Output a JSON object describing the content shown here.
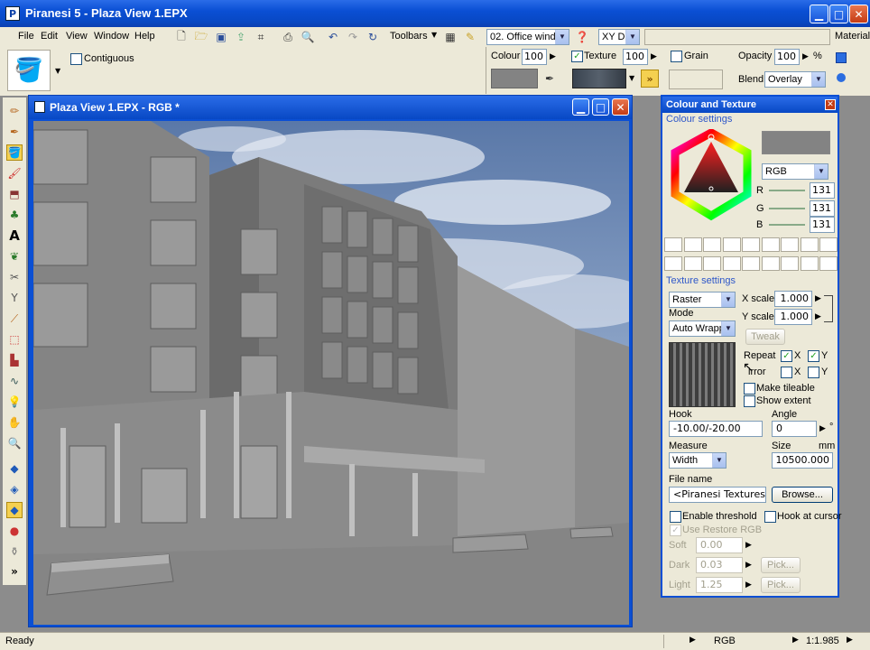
{
  "window": {
    "title": "Piranesi 5 - Plaza View 1.EPX",
    "icon": "P"
  },
  "menu": [
    "File",
    "Edit",
    "View",
    "Window",
    "Help"
  ],
  "toolbar": {
    "toolbars_label": "Toolbars",
    "view_select": "02. Office windo",
    "axis_select": "XY D",
    "materials_label": "Material"
  },
  "options": {
    "contiguous_label": "Contiguous",
    "colour_label": "Colour",
    "colour_value": "100",
    "texture_label": "Texture",
    "texture_value": "100",
    "grain_label": "Grain",
    "opacity_label": "Opacity",
    "opacity_value": "100",
    "opacity_unit": "%",
    "blend_label": "Blend",
    "blend_value": "Overlay",
    "more_symbol": "»"
  },
  "viewport": {
    "title": "Plaza View 1.EPX - RGB *"
  },
  "panel": {
    "title": "Colour and Texture",
    "colour_settings": "Colour settings",
    "colour_mode": "RGB",
    "r_label": "R",
    "r_value": "131",
    "g_label": "G",
    "g_value": "131",
    "b_label": "B",
    "b_value": "131",
    "swatch_color": "#838383",
    "texture_settings": "Texture settings",
    "texture_type": "Raster",
    "xscale_label": "X scale",
    "xscale_value": "1.000",
    "yscale_label": "Y scale",
    "yscale_value": "1.000",
    "mode_label": "Mode",
    "mode_value": "Auto Wrapp",
    "tweak_label": "Tweak",
    "repeat_label": "Repeat",
    "mirror_label": "irror",
    "x_label": "X",
    "y_label": "Y",
    "make_tileable": "Make tileable",
    "show_extent": "Show extent",
    "hook_label": "Hook",
    "hook_value": "-10.00/-20.00",
    "angle_label": "Angle",
    "angle_value": "0",
    "angle_unit": "°",
    "measure_label": "Measure",
    "measure_value": "Width",
    "size_label": "Size",
    "size_unit": "mm",
    "size_value": "10500.000",
    "filename_label": "File name",
    "filename_value": "<Piranesi Textures>f",
    "browse_label": "Browse...",
    "enable_threshold": "Enable threshold",
    "hook_at_cursor": "Hook at cursor",
    "use_restore": "Use Restore RGB",
    "soft_label": "Soft",
    "soft_value": "0.00",
    "dark_label": "Dark",
    "dark_value": "0.03",
    "light_label": "Light",
    "light_value": "1.25",
    "pick_label": "Pick..."
  },
  "status": {
    "left": "Ready",
    "mode": "RGB",
    "zoom": "1:1.985"
  }
}
